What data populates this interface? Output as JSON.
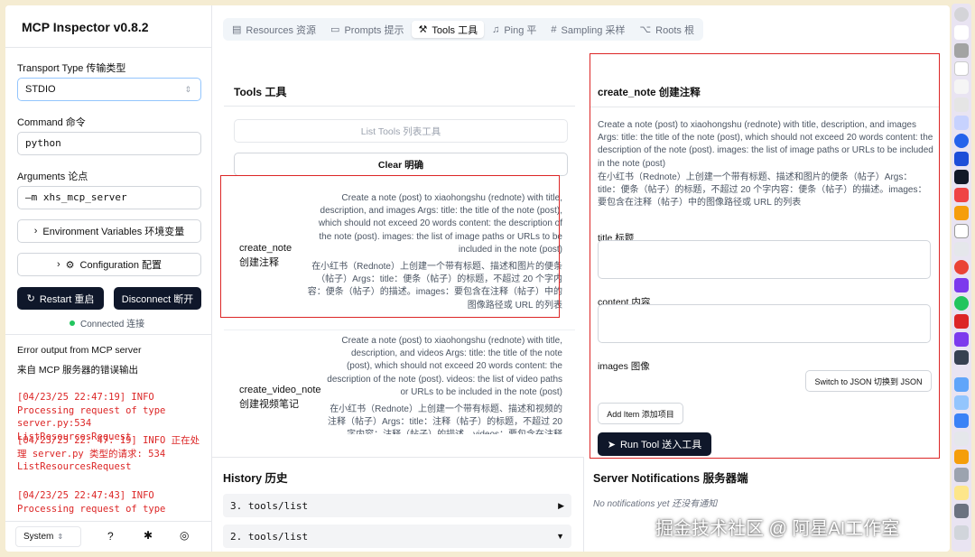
{
  "app": {
    "title": "MCP Inspector v0.8.2"
  },
  "sidebar": {
    "transport_label": "Transport Type  传输类型",
    "transport_value": "STDIO",
    "command_label": "Command  命令",
    "command_value": "python",
    "arguments_label": "Arguments  论点",
    "arguments_value": "–m xhs_mcp_server",
    "env_button": "Environment Variables  环境变量",
    "config_button": "Configuration  配置",
    "restart_button": "Restart  重启",
    "disconnect_button": "Disconnect  断开",
    "status": "Connected  连接",
    "error_title": "Error output from MCP server",
    "error_title_cn": "来自 MCP 服务器的错误输出",
    "errors": [
      "[04/23/25 22:47:19] INFO Processing request of type server.py:534 ListResourcesRequest",
      "[04/23/25 22: 47: 19] INFO 正在处理 server.py 类型的请求: 534 ListResourcesRequest",
      "[04/23/25 22:47:43] INFO Processing request of type"
    ],
    "theme_select": "System"
  },
  "tabs": [
    {
      "label": "Resources  资源",
      "icon": "resources-icon"
    },
    {
      "label": "Prompts  提示",
      "icon": "prompts-icon"
    },
    {
      "label": "Tools  工具",
      "icon": "tools-icon",
      "active": true
    },
    {
      "label": "Ping  平",
      "icon": "bell-icon"
    },
    {
      "label": "Sampling  采样",
      "icon": "hash-icon"
    },
    {
      "label": "Roots  根",
      "icon": "folder-tree-icon"
    }
  ],
  "tools_panel": {
    "title": "Tools  工具",
    "list_button": "List Tools  列表工具",
    "clear_button": "Clear  明确",
    "tools": [
      {
        "name": "create_note",
        "name_cn": "创建注释",
        "desc_en": "Create a note (post) to xiaohongshu (rednote) with title, description, and images Args: title: the title of the note (post), which should not exceed 20 words content: the description of the note (post). images: the list of image paths or URLs to be included in the note (post)",
        "desc_cn": "在小红书（Rednote）上创建一个带有标题、描述和图片的便条（帖子）Args：title：便条（帖子）的标题，不超过 20 个字内容：便条（帖子）的描述。images：要包含在注释（帖子）中的图像路径或 URL 的列表"
      },
      {
        "name": "create_video_note",
        "name_cn": "创建视频笔记",
        "desc_en": "Create a note (post) to xiaohongshu (rednote) with title, description, and videos Args: title: the title of the note (post), which should not exceed 20 words content: the description of the note (post). videos: the list of video paths or URLs to be included in the note (post)",
        "desc_cn": "在小红书（Rednote）上创建一个带有标题、描述和视频的注释（帖子）Args：title：注释（帖子）的标题，不超过 20 字内容：注释（帖子）的描述。videos：要包含在注释"
      }
    ]
  },
  "detail": {
    "title": "create_note  创建注释",
    "desc_en": "Create a note (post) to xiaohongshu (rednote) with title, description, and images Args: title: the title of the note (post), which should not exceed 20 words content: the description of the note (post). images: the list of image paths or URLs to be included in the note (post)",
    "desc_cn": "在小红书（Rednote）上创建一个带有标题、描述和图片的便条（帖子）Args：title：便条（帖子）的标题，不超过 20 个字内容：便条（帖子）的描述。images：要包含在注释（帖子）中的图像路径或 URL 的列表",
    "title_label": "title  标题",
    "content_label": "content  内容",
    "images_label": "images  图像",
    "switch_json": "Switch to JSON  切换到 JSON",
    "add_item": "Add Item  添加项目",
    "run_tool": "Run Tool  送入工具"
  },
  "history": {
    "title": "History  历史",
    "items": [
      {
        "label": "3. tools/list",
        "toggle": "▶"
      },
      {
        "label": "2. tools/list",
        "toggle": "▼"
      }
    ]
  },
  "notifications": {
    "title": "Server Notifications  服务器端",
    "empty": "No notifications yet  还没有通知"
  },
  "watermark": "掘金技术社区 @ 阿星AI工作室",
  "colors": {
    "accent_dark": "#0f172a",
    "error": "#dc2626",
    "connected": "#22c55e",
    "highlight_box": "#dc2626"
  }
}
